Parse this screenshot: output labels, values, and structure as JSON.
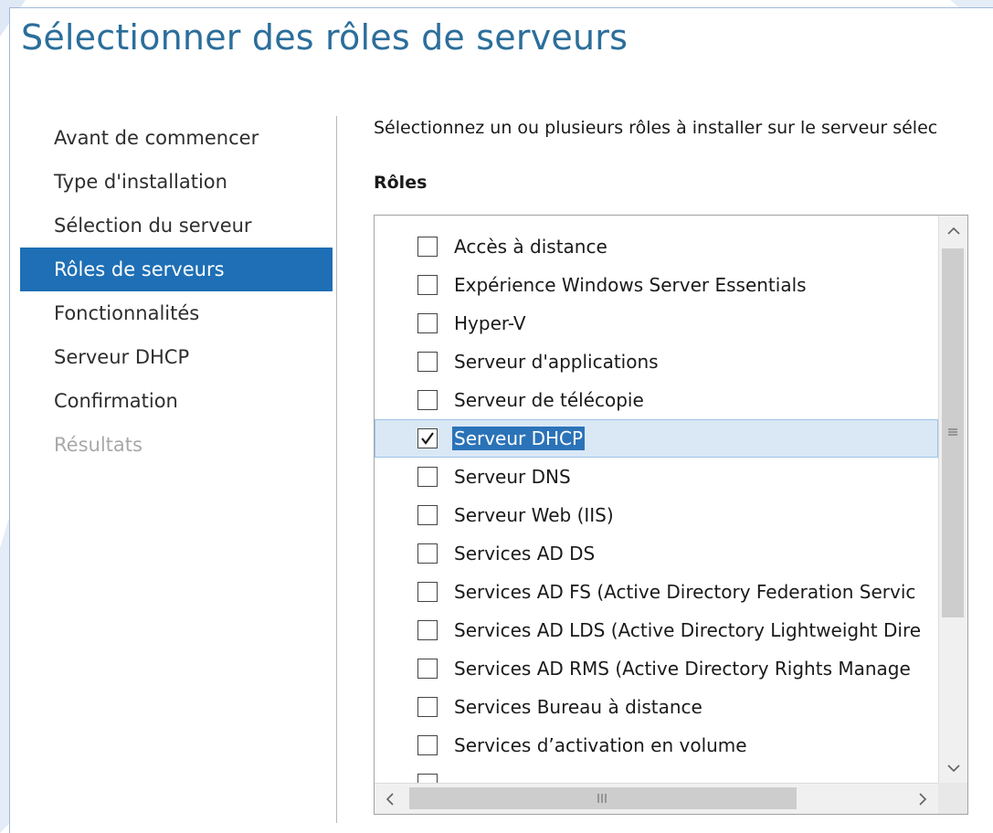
{
  "page": {
    "title": "Sélectionner des rôles de serveurs",
    "accent_color": "#2b6e9b",
    "selection_color": "#1e6fb5"
  },
  "nav": {
    "items": [
      {
        "label": "Avant de commencer",
        "state": "normal"
      },
      {
        "label": "Type d'installation",
        "state": "normal"
      },
      {
        "label": "Sélection du serveur",
        "state": "normal"
      },
      {
        "label": "Rôles de serveurs",
        "state": "active"
      },
      {
        "label": "Fonctionnalités",
        "state": "normal"
      },
      {
        "label": "Serveur DHCP",
        "state": "normal"
      },
      {
        "label": "Confirmation",
        "state": "normal"
      },
      {
        "label": "Résultats",
        "state": "disabled"
      }
    ]
  },
  "main": {
    "description": "Sélectionnez un ou plusieurs rôles à installer sur le serveur sélec",
    "roles_header": "Rôles",
    "roles": [
      {
        "label": "Accès à distance",
        "checked": false,
        "selected": false
      },
      {
        "label": "Expérience Windows Server Essentials",
        "checked": false,
        "selected": false
      },
      {
        "label": "Hyper-V",
        "checked": false,
        "selected": false
      },
      {
        "label": "Serveur d'applications",
        "checked": false,
        "selected": false
      },
      {
        "label": "Serveur de télécopie",
        "checked": false,
        "selected": false
      },
      {
        "label": "Serveur DHCP",
        "checked": true,
        "selected": true
      },
      {
        "label": "Serveur DNS",
        "checked": false,
        "selected": false
      },
      {
        "label": "Serveur Web (IIS)",
        "checked": false,
        "selected": false
      },
      {
        "label": "Services AD DS",
        "checked": false,
        "selected": false
      },
      {
        "label": "Services AD FS (Active Directory Federation Servic",
        "checked": false,
        "selected": false
      },
      {
        "label": "Services AD LDS (Active Directory Lightweight Dire",
        "checked": false,
        "selected": false
      },
      {
        "label": "Services AD RMS (Active Directory Rights Manage",
        "checked": false,
        "selected": false
      },
      {
        "label": "Services Bureau à distance",
        "checked": false,
        "selected": false
      },
      {
        "label": "Services d’activation en volume",
        "checked": false,
        "selected": false
      },
      {
        "label": "",
        "checked": false,
        "selected": false
      }
    ]
  },
  "scrollbars": {
    "up_icon": "chevron-up-icon",
    "down_icon": "chevron-down-icon",
    "left_icon": "chevron-left-icon",
    "right_icon": "chevron-right-icon"
  }
}
